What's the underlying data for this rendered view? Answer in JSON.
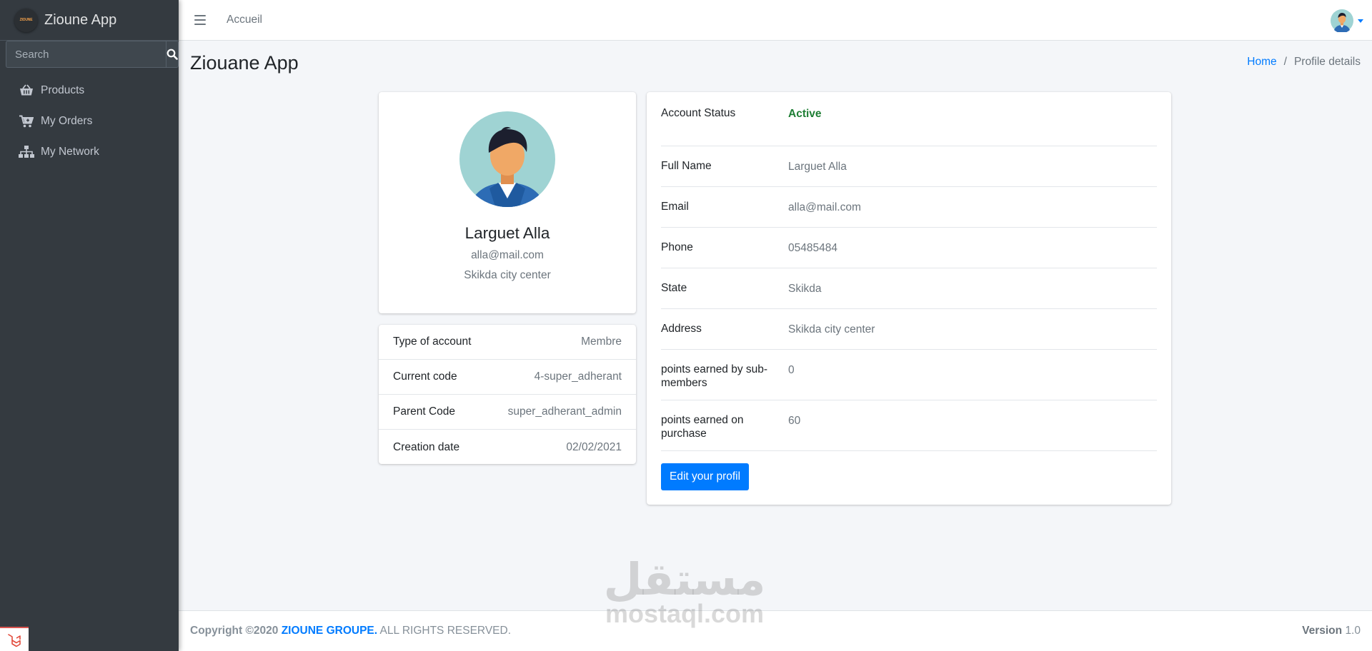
{
  "brand": {
    "name": "Zioune App",
    "logo_text": "ZIOUNE"
  },
  "search": {
    "placeholder": "Search"
  },
  "sidebar": {
    "items": [
      {
        "label": "Products",
        "icon": "basket-icon"
      },
      {
        "label": "My Orders",
        "icon": "cart-icon"
      },
      {
        "label": "My Network",
        "icon": "sitemap-icon"
      }
    ]
  },
  "topbar": {
    "link": "Accueil"
  },
  "page": {
    "title": "Ziouane App"
  },
  "breadcrumb": {
    "home": "Home",
    "separator": "/",
    "current": "Profile details"
  },
  "profile": {
    "name": "Larguet Alla",
    "email": "alla@mail.com",
    "address": "Skikda city center"
  },
  "meta": {
    "rows": [
      {
        "key": "Type of account",
        "value": "Membre"
      },
      {
        "key": "Current code",
        "value": "4-super_adherant"
      },
      {
        "key": "Parent Code",
        "value": "super_adherant_admin"
      },
      {
        "key": "Creation date",
        "value": "02/02/2021"
      }
    ]
  },
  "details": {
    "status_label": "Account Status",
    "status_value": "Active",
    "rows": [
      {
        "key": "Full Name",
        "value": "Larguet Alla"
      },
      {
        "key": "Email",
        "value": "alla@mail.com"
      },
      {
        "key": "Phone",
        "value": "05485484"
      },
      {
        "key": "State",
        "value": "Skikda"
      },
      {
        "key": "Address",
        "value": "Skikda city center"
      },
      {
        "key": "points earned by sub-members",
        "value": "0"
      },
      {
        "key": "points earned on purchase",
        "value": "60"
      }
    ],
    "edit_label": "Edit your profil"
  },
  "footer": {
    "copyright": "Copyright ©2020",
    "company": "ZIOUNE GROUPE.",
    "rights": "ALL RIGHTS RESERVED.",
    "version_label": "Version",
    "version_value": "1.0"
  },
  "watermark": {
    "arabic": "مستقل",
    "latin": "mostaql.com"
  },
  "colors": {
    "primary": "#007bff",
    "sidebar": "#343a40",
    "active": "#1e7e34"
  }
}
